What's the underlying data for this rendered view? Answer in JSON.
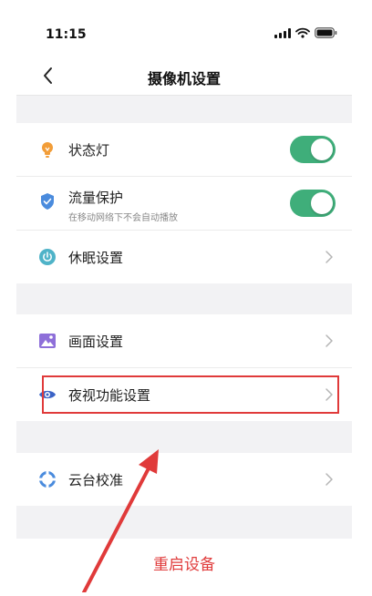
{
  "status_bar": {
    "time": "11:15"
  },
  "nav": {
    "title": "摄像机设置"
  },
  "group1": {
    "status_light": {
      "label": "状态灯",
      "enabled": true
    },
    "traffic_protection": {
      "label": "流量保护",
      "subtitle": "在移动网络下不会自动播放",
      "enabled": true
    },
    "sleep_settings": {
      "label": "休眠设置"
    }
  },
  "group2": {
    "picture_settings": {
      "label": "画面设置"
    },
    "night_vision_settings": {
      "label": "夜视功能设置"
    }
  },
  "group3": {
    "ptz_calibration": {
      "label": "云台校准"
    }
  },
  "restart": {
    "label": "重启设备"
  },
  "colors": {
    "toggle_on": "#3fae7a",
    "danger": "#e03c3c",
    "annotation": "#e03a3a"
  }
}
